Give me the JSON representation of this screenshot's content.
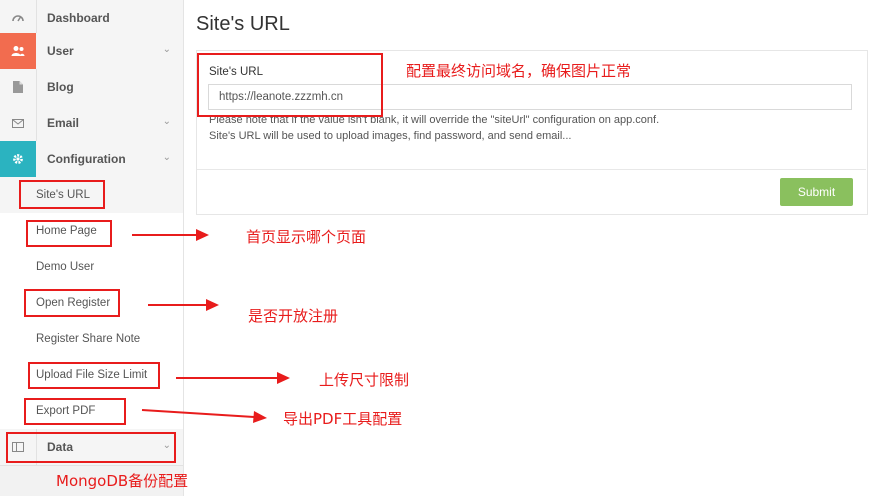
{
  "sidebar": {
    "items": [
      {
        "label": "Dashboard",
        "icon": "dashboard-icon"
      },
      {
        "label": "User",
        "icon": "users-icon"
      },
      {
        "label": "Blog",
        "icon": "file-icon"
      },
      {
        "label": "Email",
        "icon": "envelope-icon"
      },
      {
        "label": "Configuration",
        "icon": "gear-icon"
      }
    ],
    "submenu": [
      "Site's URL",
      "Home Page",
      "Demo User",
      "Open Register",
      "Register Share Note",
      "Upload File Size Limit",
      "Export PDF"
    ],
    "data_item": {
      "label": "Data",
      "icon": "table-icon"
    }
  },
  "main": {
    "title": "Site's URL",
    "field_label": "Site's URL",
    "url_value": "https://leanote.zzzmh.cn",
    "help_line1": "Please note that if the value isn't blank, it will override the \"siteUrl\" configuration on app.conf.",
    "help_line2": "Site's URL will be used to upload images, find password, and send email...",
    "submit_label": "Submit"
  },
  "annotations": {
    "site_url": "配置最终访问域名，确保图片正常",
    "home_page": "首页显示哪个页面",
    "open_register": "是否开放注册",
    "upload_limit": "上传尺寸限制",
    "export_pdf": "导出PDF工具配置",
    "mongodb": "MongoDB备份配置"
  },
  "colors": {
    "annotation_red": "#e81c1c",
    "user_icon_bg": "#f26c4f",
    "config_icon_bg": "#2bb3c0",
    "submit_bg": "#8ac05e"
  }
}
